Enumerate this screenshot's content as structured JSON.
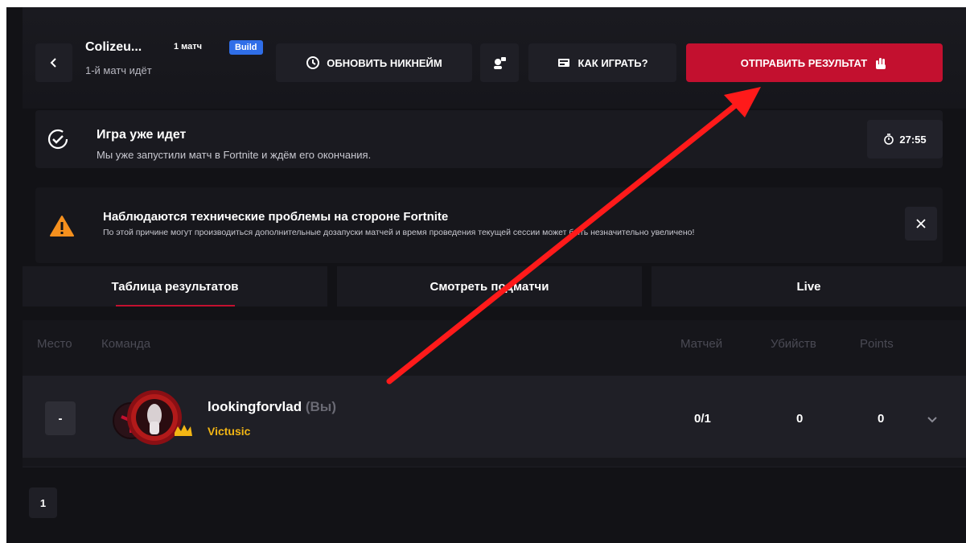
{
  "header": {
    "back_icon": "chevron-left-icon",
    "match_title": "Colizeu...",
    "match_count": "1 матч",
    "mode_badge": "Build",
    "match_status": "1-й матч идёт",
    "update_nickname_label": "ОБНОВИТЬ НИКНЕЙМ",
    "update_icon": "history-icon",
    "support_icon": "support-agent-icon",
    "how_to_play_label": "КАК ИГРАТЬ?",
    "how_to_play_icon": "book-icon",
    "submit_result_label": "ОТПРАВИТЬ РЕЗУЛЬТАТ",
    "submit_icon": "hand-icon"
  },
  "status": {
    "title": "Игра уже идет",
    "description": "Мы уже запустили матч в Fortnite и ждём его окончания.",
    "icon": "check-circle-icon",
    "timer": "27:55",
    "timer_icon": "timer-icon"
  },
  "warning": {
    "title": "Наблюдаются технические проблемы на стороне Fortnite",
    "description": "По этой причине могут производиться дополнительные дозапуски матчей и время проведения текущей сессии может быть незначительно увеличено!",
    "icon": "warning-icon",
    "close_icon": "close-icon"
  },
  "tabs": [
    {
      "label": "Таблица результатов",
      "active": true
    },
    {
      "label": "Смотреть подматчи",
      "active": false
    },
    {
      "label": "Live",
      "active": false
    }
  ],
  "table": {
    "columns": [
      "Место",
      "Команда",
      "Матчей",
      "Убийств",
      "Points"
    ],
    "rows": [
      {
        "place": "-",
        "player": "lookingforvlad",
        "you_tag": "(Вы)",
        "team": "Victusic",
        "matches": "0/1",
        "kills": "0",
        "points": "0"
      }
    ]
  },
  "pagination": {
    "current": "1"
  },
  "colors": {
    "background": "#121216",
    "card": "#1a1a20",
    "accent_red": "#c3102f",
    "badge_blue": "#2f6ee8",
    "team_gold": "#f3b614",
    "warning_orange": "#f5901e",
    "annotation_arrow": "#ff1a1a"
  }
}
